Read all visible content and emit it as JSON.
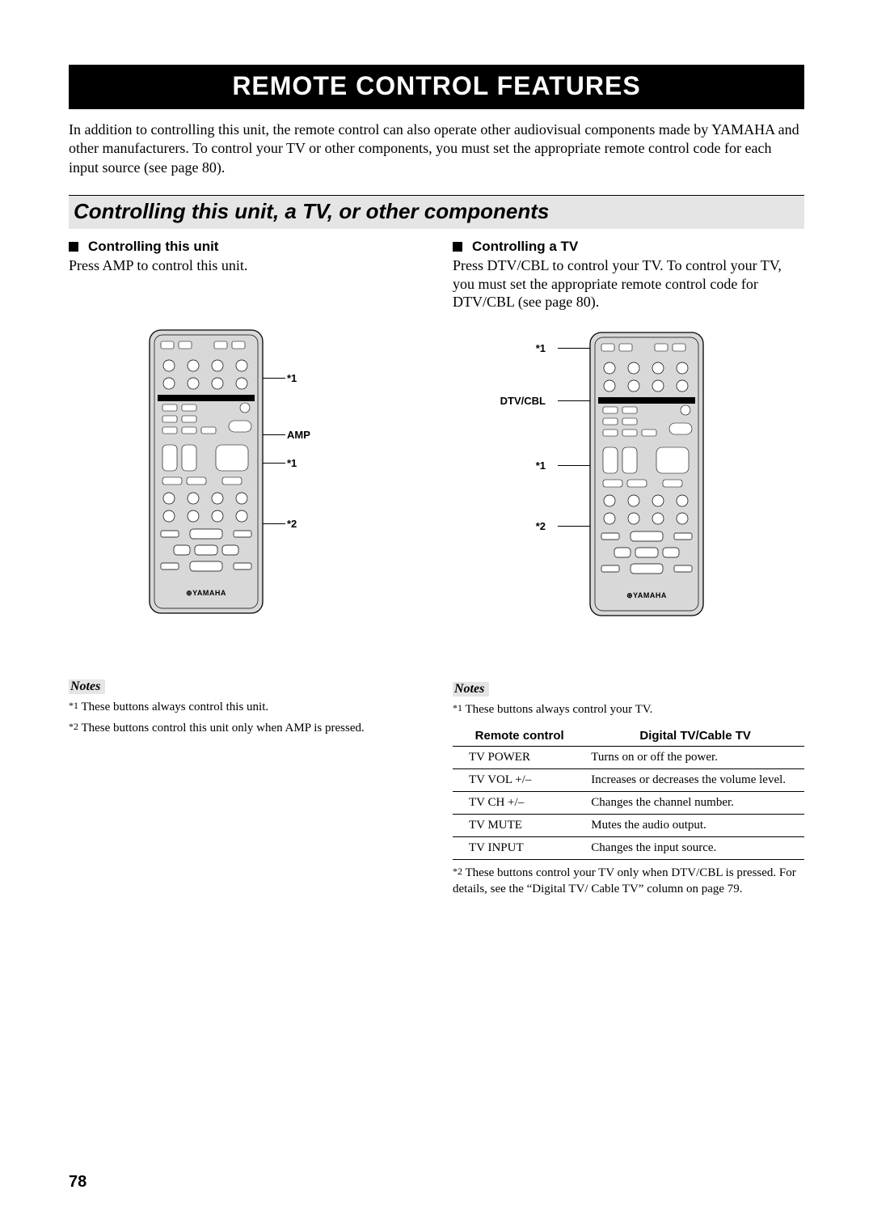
{
  "banner": "REMOTE CONTROL FEATURES",
  "intro": "In addition to controlling this unit, the remote control can also operate other audiovisual components made by YAMAHA and other manufacturers. To control your TV or other components, you must set the appropriate remote control code for each input source (see page 80).",
  "section_title": "Controlling this unit, a TV, or other components",
  "left": {
    "sub_head": "Controlling this unit",
    "body": "Press AMP to control this unit.",
    "remote_brand": "YAMAHA",
    "callouts": {
      "a": "*1",
      "b": "AMP",
      "c": "*1",
      "d": "*2"
    },
    "notes_head": "Notes",
    "note1_fn": "*1",
    "note1": "These buttons always control this unit.",
    "note2_fn": "*2",
    "note2": "These buttons control this unit only when AMP is pressed."
  },
  "right": {
    "sub_head": "Controlling a TV",
    "body": "Press DTV/CBL to control your TV. To control your TV, you must set the appropriate remote control code for DTV/CBL (see page 80).",
    "remote_brand": "YAMAHA",
    "callouts": {
      "a": "*1",
      "b": "DTV/CBL",
      "c": "*1",
      "d": "*2"
    },
    "notes_head": "Notes",
    "note1_fn": "*1",
    "note1": "These buttons always control your TV.",
    "table_head_left": "Remote control",
    "table_head_right": "Digital TV/Cable TV",
    "table": [
      {
        "label": "TV POWER",
        "desc": "Turns on or off the power."
      },
      {
        "label": "TV VOL +/–",
        "desc": "Increases or decreases the volume level."
      },
      {
        "label": "TV CH +/–",
        "desc": "Changes the channel number."
      },
      {
        "label": "TV MUTE",
        "desc": "Mutes the audio output."
      },
      {
        "label": "TV INPUT",
        "desc": "Changes the input source."
      }
    ],
    "note2_fn": "*2",
    "note2": "These buttons control your TV only when DTV/CBL is pressed. For details, see the “Digital TV/ Cable TV” column on page 79."
  },
  "page_number": "78"
}
